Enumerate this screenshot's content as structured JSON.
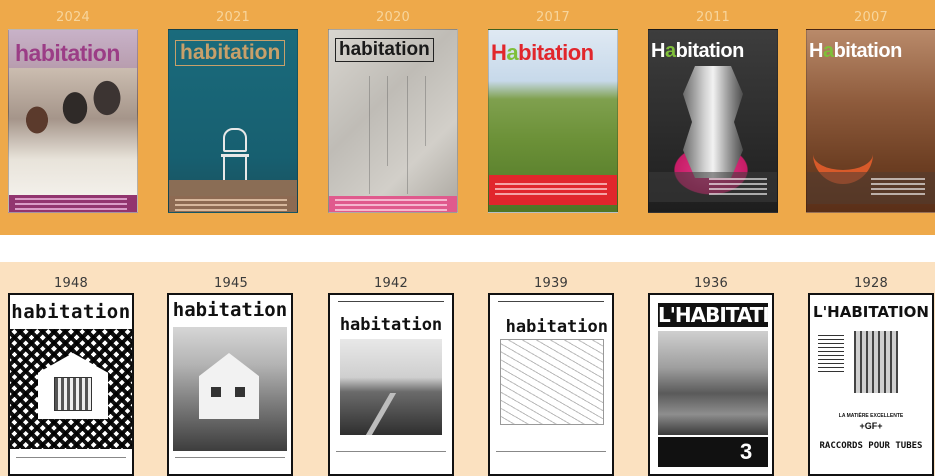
{
  "recent_row": {
    "background": "#eea94a",
    "items": [
      {
        "year": "2024",
        "masthead": "habitation",
        "accent": "#9b3d86"
      },
      {
        "year": "2021",
        "masthead": "habitation",
        "accent": "#c8a06a"
      },
      {
        "year": "2020",
        "masthead": "habitation",
        "accent": "#e05a8d"
      },
      {
        "year": "2017",
        "masthead_h": "H",
        "masthead_a": "a",
        "masthead_rest": "bitation",
        "accent": "#e1262c"
      },
      {
        "year": "2011",
        "masthead_h": "H",
        "masthead_a": "a",
        "masthead_rest": "bitation",
        "accent": "#7fbf3a"
      },
      {
        "year": "2007",
        "masthead_h": "H",
        "masthead_a": "a",
        "masthead_rest": "bitation",
        "accent": "#7fbf3a"
      }
    ]
  },
  "archive_row": {
    "background": "#fbe1c0",
    "items": [
      {
        "year": "1948",
        "masthead": "habitation"
      },
      {
        "year": "1945",
        "masthead": "habitation"
      },
      {
        "year": "1942",
        "masthead": "habitation"
      },
      {
        "year": "1939",
        "masthead": "habitation"
      },
      {
        "year": "1936",
        "masthead": "L'HABITATION",
        "issue_number": "3"
      },
      {
        "year": "1928",
        "masthead": "L'HABITATION",
        "ad_line1": "LA MATIÈRE EXCELLENTE",
        "ad_line2": "RACCORDS POUR TUBES",
        "ad_line3": "+GF+"
      }
    ]
  }
}
